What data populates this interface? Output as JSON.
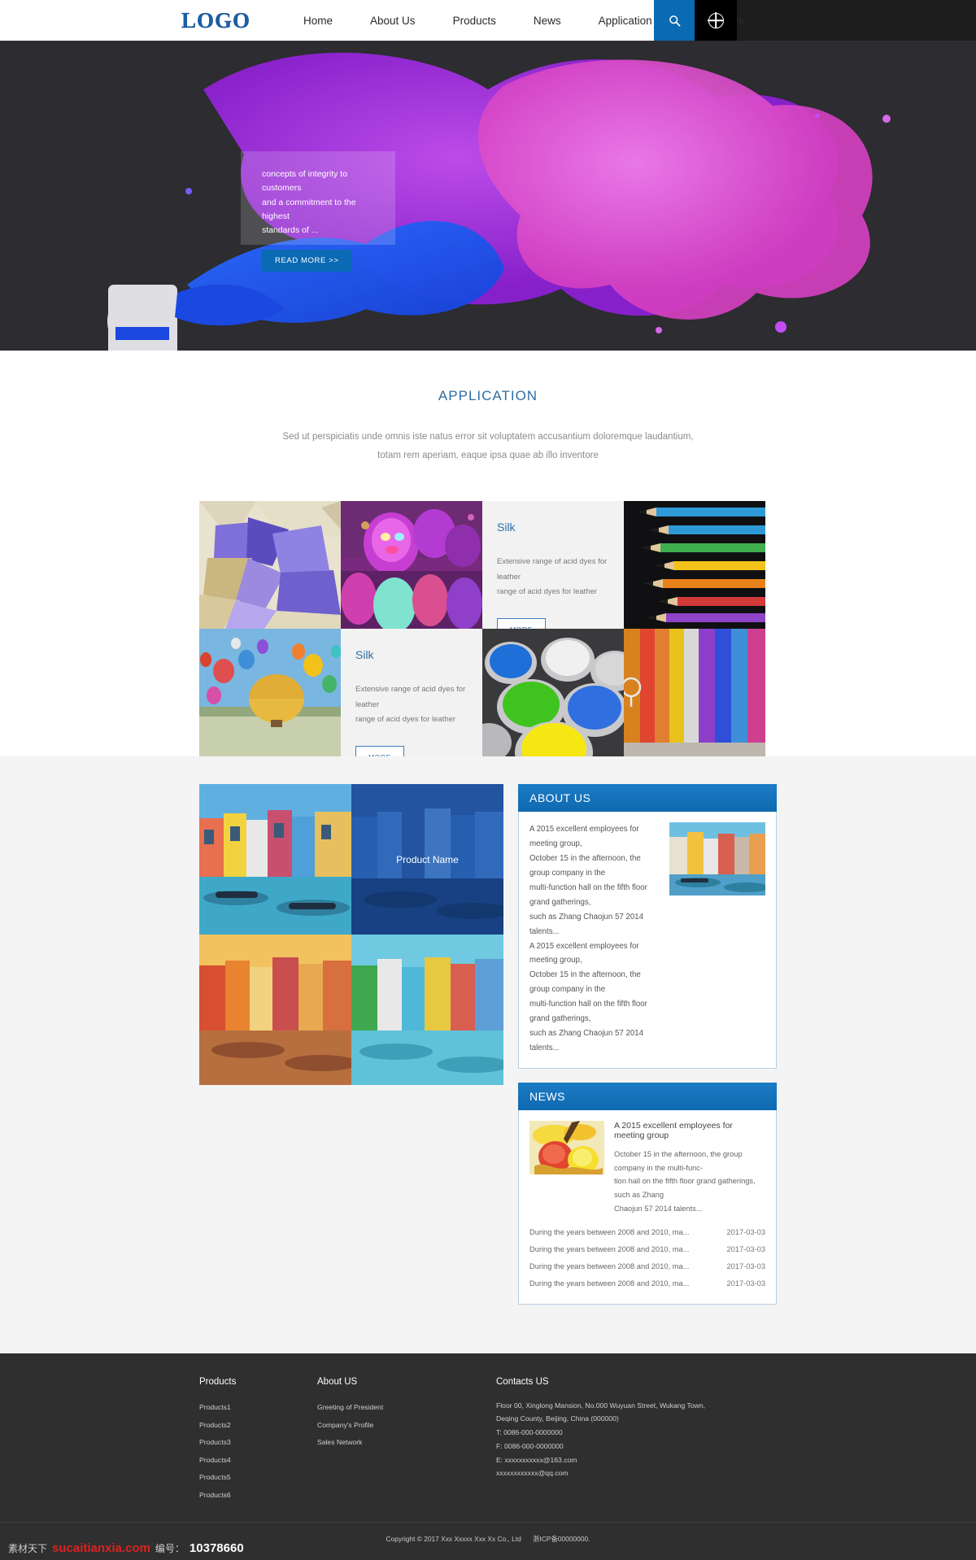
{
  "header": {
    "logo": "LOGO",
    "nav": [
      {
        "label": "Home"
      },
      {
        "label": "About Us"
      },
      {
        "label": "Products"
      },
      {
        "label": "News"
      },
      {
        "label": "Application"
      },
      {
        "label": "Contact Us"
      }
    ],
    "search_icon": "search-icon",
    "language_icon": "globe-icon"
  },
  "hero": {
    "caption_line1": "concepts of integrity to customers",
    "caption_line2": "and a commitment to the highest",
    "caption_line3": "standards of ...",
    "button": "READ MORE >>",
    "accent": "#0a6ab3"
  },
  "application": {
    "title": "APPLICATION",
    "subtitle_line1": "Sed ut perspiciatis unde omnis iste natus error sit voluptatem accusantium doloremque laudantium,",
    "subtitle_line2": "totam rem aperiam, eaque ipsa quae ab illo inventore",
    "cards": [
      {
        "title": "Silk",
        "desc_line1": "Extensive range of acid dyes for leather",
        "desc_line2": "range of acid dyes for leather",
        "button": "MORE"
      },
      {
        "title": "Silk",
        "desc_line1": "Extensive range of acid dyes for leather",
        "desc_line2": "range of acid dyes for leather",
        "button": "MORE"
      }
    ]
  },
  "gallery": {
    "product_name": "Product Name"
  },
  "about": {
    "heading": "ABOUT US",
    "para1_l1": "A 2015 excellent employees for meeting group,",
    "para1_l2": "October 15 in the afternoon, the group company in the",
    "para1_l3": "multi-function hall on the fifth floor grand gatherings,",
    "para1_l4": "such as Zhang Chaojun 57 2014 talents...",
    "para2_l1": "A 2015 excellent employees for meeting group,",
    "para2_l2": "October 15 in the afternoon, the group company in the",
    "para2_l3": "multi-function hall on the fifth floor grand gatherings,",
    "para2_l4": "such as Zhang Chaojun 57 2014 talents..."
  },
  "news": {
    "heading": "NEWS",
    "featured_title": "A 2015 excellent employees for meeting group",
    "featured_l1": "October 15 in the afternoon, the group company in the multi-func-",
    "featured_l2": "tion hall on the fifth floor grand gatherings, such as Zhang",
    "featured_l3": "Chaojun 57 2014 talents...",
    "items": [
      {
        "title": "During the years between 2008 and 2010, ma...",
        "date": "2017-03-03"
      },
      {
        "title": "During the years between 2008 and 2010, ma...",
        "date": "2017-03-03"
      },
      {
        "title": "During the years between 2008 and 2010, ma...",
        "date": "2017-03-03"
      },
      {
        "title": "During the years between 2008 and 2010, ma...",
        "date": "2017-03-03"
      }
    ]
  },
  "footer": {
    "products_heading": "Products",
    "products": [
      {
        "label": "Products1"
      },
      {
        "label": "Products2"
      },
      {
        "label": "Products3"
      },
      {
        "label": "Products4"
      },
      {
        "label": "Products5"
      },
      {
        "label": "Products6"
      }
    ],
    "about_heading": "About US",
    "about_links": [
      {
        "label": "Greeting of President"
      },
      {
        "label": "Company's Profile"
      },
      {
        "label": "Sales Network"
      }
    ],
    "contacts_heading": "Contacts US",
    "address_l1": "Floor 00, Xinglong Mansion, No.000 Wuyuan Street, Wukang Town,",
    "address_l2": "Deqing County, Beijing, China (000000)",
    "tel": "T: 0086-000-0000000",
    "fax": "F: 0086-000-0000000",
    "email1": "E: xxxxxxxxxxx@163.com",
    "email2": "xxxxxxxxxxxx@qq.com",
    "copyright": "Copyright © 2017 Xxx Xxxxx Xxx Xx Co., Ltd",
    "icp": "浙ICP备00000000."
  },
  "watermark": {
    "cn": "素材天下",
    "site": "sucaitianxia.com",
    "label": "编号：",
    "number": "10378660"
  }
}
